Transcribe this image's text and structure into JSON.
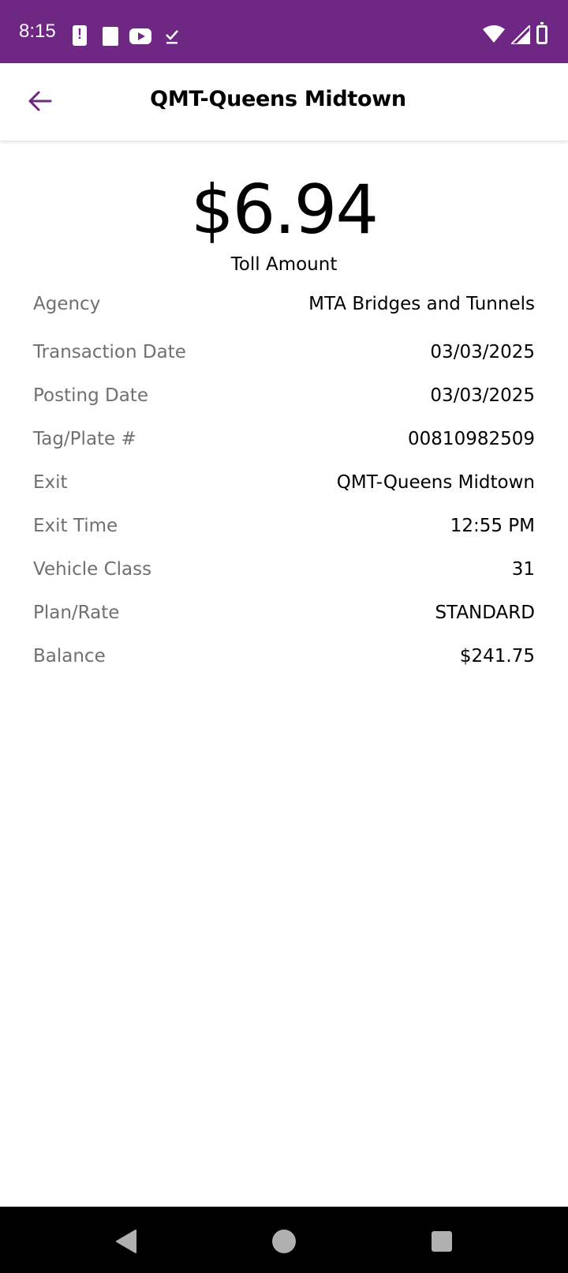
{
  "status_bar": {
    "time": "8:15",
    "icons": [
      "alert-icon",
      "document-icon",
      "youtube-icon",
      "download-done-icon",
      "wifi-icon",
      "signal-icon",
      "battery-icon"
    ],
    "background": "#6e2884"
  },
  "app_bar": {
    "title": "QMT-Queens Midtown",
    "back_icon": "arrow-left-icon",
    "accent": "#6e2884"
  },
  "toll": {
    "amount": "$6.94",
    "label": "Toll Amount"
  },
  "details": [
    {
      "label": "Agency",
      "value": "MTA Bridges and Tunnels"
    },
    {
      "label": "Transaction Date",
      "value": "03/03/2025"
    },
    {
      "label": "Posting Date",
      "value": "03/03/2025"
    },
    {
      "label": "Tag/Plate #",
      "value": "00810982509"
    },
    {
      "label": "Exit",
      "value": "QMT-Queens Midtown"
    },
    {
      "label": "Exit Time",
      "value": "12:55 PM"
    },
    {
      "label": "Vehicle Class",
      "value": "31"
    },
    {
      "label": "Plan/Rate",
      "value": "STANDARD"
    },
    {
      "label": "Balance",
      "value": "$241.75"
    }
  ],
  "nav_bar": {
    "buttons": [
      "nav-back-icon",
      "nav-home-icon",
      "nav-recents-icon"
    ]
  }
}
